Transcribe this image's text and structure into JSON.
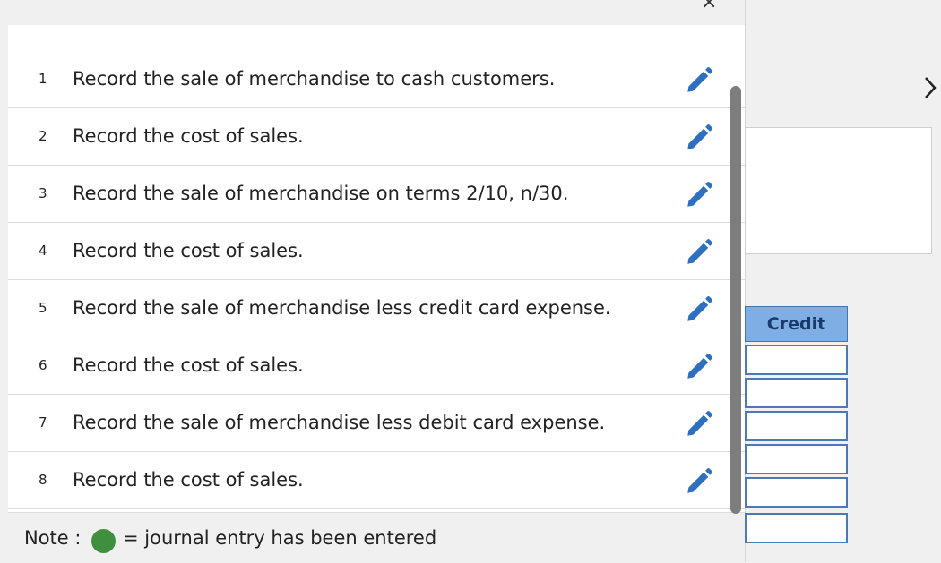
{
  "entries": [
    {
      "num": "1",
      "text": "Record the sale of merchandise to cash customers."
    },
    {
      "num": "2",
      "text": "Record the cost of sales."
    },
    {
      "num": "3",
      "text": "Record the sale of merchandise on terms 2/10, n/30."
    },
    {
      "num": "4",
      "text": "Record the cost of sales."
    },
    {
      "num": "5",
      "text": "Record the sale of merchandise less credit card expense."
    },
    {
      "num": "6",
      "text": "Record the cost of sales."
    },
    {
      "num": "7",
      "text": "Record the sale of merchandise less debit card expense."
    },
    {
      "num": "8",
      "text": "Record the cost of sales."
    }
  ],
  "note": {
    "label": "Note :",
    "description": "= journal entry has been entered"
  },
  "background": {
    "credit_header": "Credit",
    "next_glyph": "›",
    "close_glyph": "×"
  },
  "icons": {
    "edit": "pencil-icon",
    "entered_marker": "green-dot-icon",
    "next": "chevron-right-icon"
  },
  "colors": {
    "pencil": "#2f6fbf",
    "entered_dot": "#3f8f3f",
    "credit_header_bg": "#7eaee3",
    "grid_border": "#4f79b3"
  }
}
